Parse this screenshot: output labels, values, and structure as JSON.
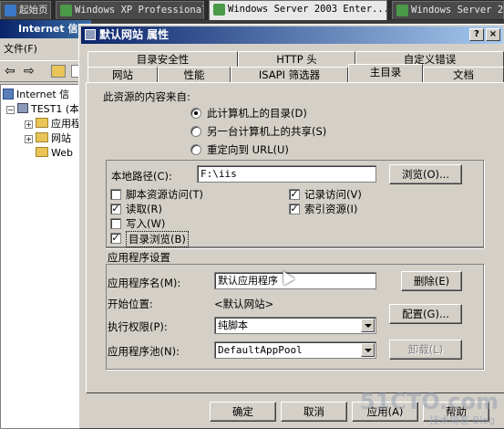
{
  "vm_tabs": [
    {
      "label": "起始页",
      "color": "#3a78c8"
    },
    {
      "label": "Windows XP Professional",
      "color": "#4a9a48"
    },
    {
      "label": "Windows Server 2003 Enter...",
      "color": "#4a9a48"
    },
    {
      "label": "Windows Server 20",
      "color": "#4a9a48"
    }
  ],
  "bg_window": {
    "title": "Internet 信",
    "menu_file": "文件(F)",
    "tree": [
      {
        "label": "Internet 信"
      },
      {
        "label": "TEST1 (本"
      },
      {
        "label": "应用程"
      },
      {
        "label": "网站"
      },
      {
        "label": "Web"
      }
    ]
  },
  "dialog": {
    "title": "默认网站 属性",
    "help_btn": "?",
    "close_btn": "×",
    "tabs_row1": [
      "目录安全性",
      "HTTP 头",
      "自定义错误"
    ],
    "tabs_row2": [
      "网站",
      "性能",
      "ISAPI 筛选器",
      "主目录",
      "文档"
    ],
    "content_from_label": "此资源的内容来自:",
    "radios": [
      {
        "label": "此计算机上的目录(D)",
        "checked": true
      },
      {
        "label": "另一台计算机上的共享(S)",
        "checked": false
      },
      {
        "label": "重定向到 URL(U)",
        "checked": false
      }
    ],
    "local_path_label": "本地路径(C):",
    "local_path_value": "F:\\iis",
    "browse_btn": "浏览(O)...",
    "checks_left": [
      {
        "label": "脚本资源访问(T)",
        "checked": false
      },
      {
        "label": "读取(R)",
        "checked": true
      },
      {
        "label": "写入(W)",
        "checked": false
      },
      {
        "label": "目录浏览(B)",
        "checked": true
      }
    ],
    "checks_right": [
      {
        "label": "记录访问(V)",
        "checked": true
      },
      {
        "label": "索引资源(I)",
        "checked": true
      }
    ],
    "app_settings_label": "应用程序设置",
    "app_name_label": "应用程序名(M):",
    "app_name_value": "默认应用程序",
    "remove_btn": "删除(E)",
    "start_point_label": "开始位置:",
    "start_point_value": "<默认网站>",
    "config_btn": "配置(G)...",
    "exec_perm_label": "执行权限(P):",
    "exec_perm_value": "纯脚本",
    "app_pool_label": "应用程序池(N):",
    "app_pool_value": "DefaultAppPool",
    "unload_btn": "卸载(L)",
    "ok_btn": "确定",
    "cancel_btn": "取消",
    "apply_btn": "应用(A)",
    "help_bottom_btn": "帮助"
  },
  "watermark": {
    "main": "51CTO.com",
    "sub": "技术博客 Blog"
  }
}
